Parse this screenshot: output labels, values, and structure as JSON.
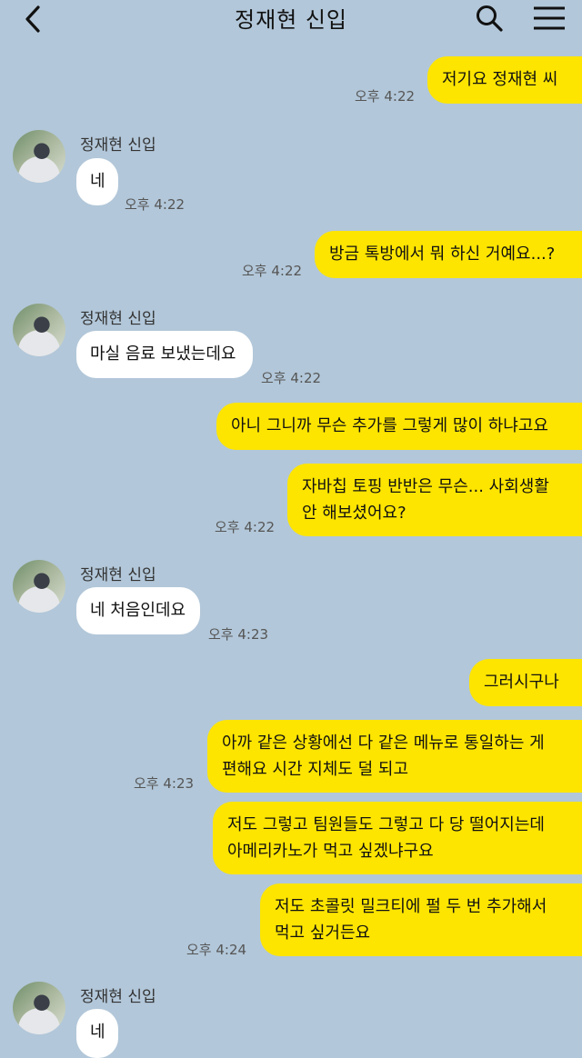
{
  "header": {
    "title": "정재현 신입"
  },
  "messages": [
    {
      "text": "저기요 정재현 씨",
      "time": "오후 4:22"
    },
    {
      "sender": "정재현 신입",
      "text": "네",
      "time": "오후 4:22"
    },
    {
      "text": "방금 톡방에서 뭐 하신 거예요...?",
      "time": "오후 4:22"
    },
    {
      "sender": "정재현 신입",
      "text": "마실 음료 보냈는데요",
      "time": "오후 4:22"
    },
    {
      "text": "아니 그니까 무슨 추가를 그렇게 많이 하냐고요"
    },
    {
      "text_line1": "자바칩 토핑 반반은 무슨... 사회생활",
      "text_line2": "안 해보셨어요?",
      "time": "오후 4:22"
    },
    {
      "sender": "정재현 신입",
      "text": "네 처음인데요",
      "time": "오후 4:23"
    },
    {
      "text": "그러시구나"
    },
    {
      "text_line1": "아까 같은 상황에선 다 같은 메뉴로 통일하는 게",
      "text_line2": "편해요 시간 지체도 덜 되고",
      "time": "오후 4:23"
    },
    {
      "text_line1": "저도 그렇고 팀원들도 그렇고 다 당 떨어지는데",
      "text_line2": "아메리카노가 먹고 싶겠냐구요"
    },
    {
      "text_line1": "저도 초콜릿 밀크티에 펄 두 번 추가해서",
      "text_line2": "먹고 싶거든요",
      "time": "오후 4:24"
    },
    {
      "sender": "정재현 신입",
      "text": "네"
    }
  ],
  "colors": {
    "background": "#b2c7d9",
    "my_bubble": "#fee500",
    "other_bubble": "#ffffff"
  },
  "icons": [
    "chevron-left-icon",
    "search-icon",
    "menu-icon"
  ]
}
